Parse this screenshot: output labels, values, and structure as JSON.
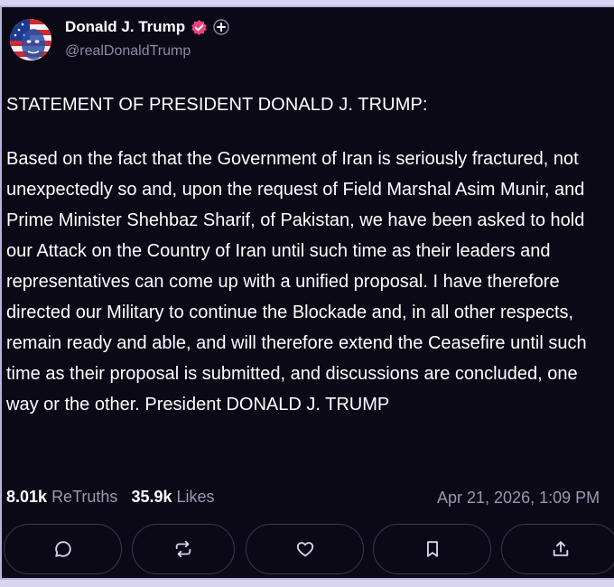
{
  "profile": {
    "display_name": "Donald J. Trump",
    "handle": "@realDonaldTrump",
    "avatar_icon": "avatar-flag-portrait",
    "verified_icon": "verified-badge-icon",
    "plus_icon": "plus-badge-icon"
  },
  "post": {
    "heading": "STATEMENT OF PRESIDENT DONALD J. TRUMP:",
    "body": "Based on the fact that the Government of Iran is seriously fractured, not unexpectedly so and, upon the request of Field Marshal Asim Munir, and Prime Minister Shehbaz Sharif, of Pakistan, we have been asked to hold our Attack on the Country of Iran until such time as their leaders and representatives can come up with a unified proposal. I have therefore directed our Military to continue the Blockade and, in all other respects, remain ready and able, and will therefore extend the Ceasefire until such time as their proposal is submitted, and discussions are concluded, one way or the other. President DONALD J. TRUMP"
  },
  "stats": {
    "retruths_count": "8.01k",
    "retruths_label": "ReTruths",
    "likes_count": "35.9k",
    "likes_label": "Likes",
    "timestamp": "Apr 21, 2026, 1:09 PM"
  },
  "actions": {
    "reply_icon": "comment-icon",
    "retruth_icon": "retruth-icon",
    "like_icon": "heart-icon",
    "bookmark_icon": "bookmark-icon",
    "share_icon": "share-icon"
  },
  "colors": {
    "background": "#0c0917",
    "verified": "#e8457a",
    "muted_text": "#9a98ae",
    "frame_border": "#b9b4e2"
  }
}
